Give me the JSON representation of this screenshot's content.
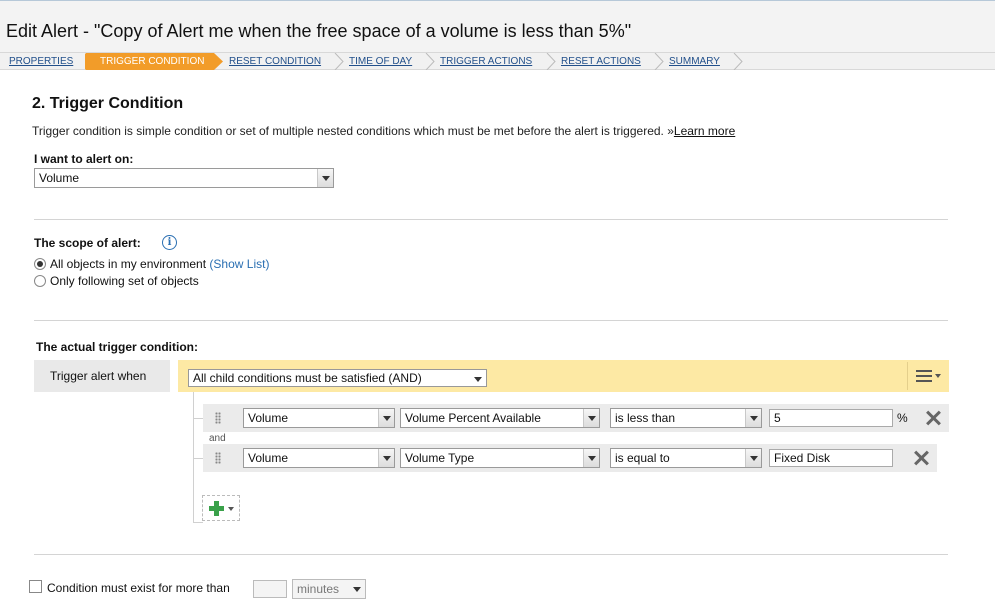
{
  "page": {
    "title": "Edit Alert - \"Copy of Alert me when the free space of a volume is less than 5%\""
  },
  "wizard": {
    "steps": [
      {
        "label": "PROPERTIES"
      },
      {
        "label": "TRIGGER CONDITION"
      },
      {
        "label": "RESET CONDITION"
      },
      {
        "label": "TIME OF DAY"
      },
      {
        "label": "TRIGGER ACTIONS"
      },
      {
        "label": "RESET ACTIONS"
      },
      {
        "label": "SUMMARY"
      }
    ],
    "active_step": 1
  },
  "section": {
    "title": "2. Trigger Condition",
    "description": "Trigger condition is simple condition or set of multiple nested conditions which must be met before the alert is triggered. »",
    "learn_more": "Learn more"
  },
  "alert_on": {
    "label": "I want to alert on:",
    "value": "Volume"
  },
  "scope": {
    "label": "The scope of alert:",
    "options": [
      {
        "label": "All objects in my environment",
        "link": "(Show List)",
        "selected": true
      },
      {
        "label": "Only following set of objects",
        "selected": false
      }
    ]
  },
  "trigger": {
    "heading": "The actual trigger condition:",
    "when_label": "Trigger alert when",
    "group_mode": "All child conditions must be satisfied (AND)",
    "conjunction": "and",
    "conditions": [
      {
        "object": "Volume",
        "field": "Volume Percent Available",
        "operator": "is less than",
        "value": "5",
        "unit": "%"
      },
      {
        "object": "Volume",
        "field": "Volume Type",
        "operator": "is equal to",
        "value": "Fixed Disk",
        "unit": ""
      }
    ]
  },
  "duration": {
    "label": "Condition must exist for more than",
    "value": "",
    "unit": "minutes",
    "checked": false
  },
  "icons": {
    "info": "info-icon",
    "menu": "menu-icon",
    "drag": "drag-handle-icon",
    "remove": "close-icon",
    "add": "plus-icon"
  }
}
